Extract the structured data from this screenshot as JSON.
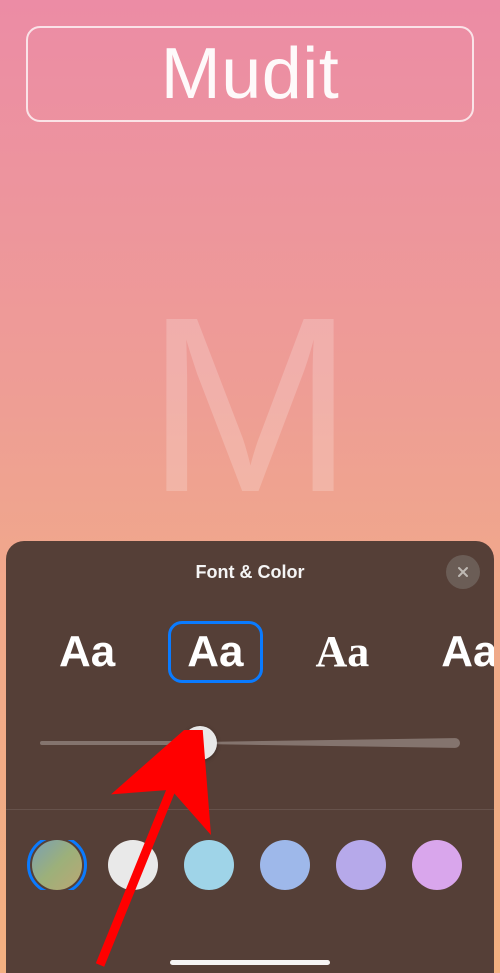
{
  "poster": {
    "contact_name": "Mudit",
    "monogram_letter": "M"
  },
  "panel": {
    "title": "Font & Color",
    "fonts": [
      {
        "sample": "Aa",
        "style_class": "font-san",
        "selected": false
      },
      {
        "sample": "Aa",
        "style_class": "font-rounded",
        "selected": true
      },
      {
        "sample": "Aa",
        "style_class": "font-serif",
        "selected": false
      },
      {
        "sample": "Aa",
        "style_class": "font-mono",
        "selected": false
      }
    ],
    "weight_slider": {
      "min": 0,
      "max": 100,
      "value": 38
    },
    "colors": [
      {
        "hex": "linear-gradient(135deg,#7aa0b4,#9cb07a,#bba874)",
        "selected": true
      },
      {
        "hex": "#e9e9e9",
        "selected": false
      },
      {
        "hex": "#9fd4e8",
        "selected": false
      },
      {
        "hex": "#9eb8ea",
        "selected": false
      },
      {
        "hex": "#b6a9ea",
        "selected": false
      },
      {
        "hex": "#d9a6ec",
        "selected": false
      }
    ]
  },
  "annotation": {
    "arrow_color": "#ff0000"
  }
}
